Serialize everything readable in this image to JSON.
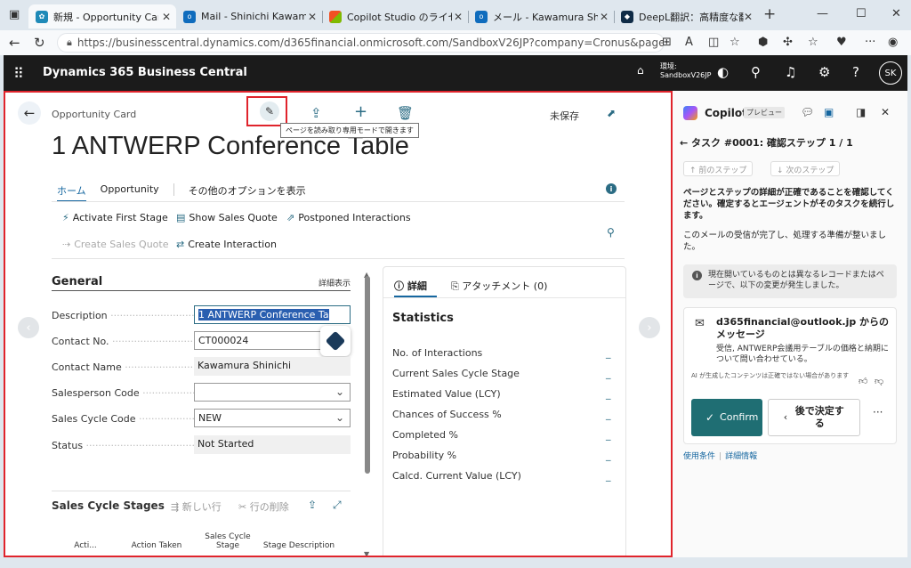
{
  "browser": {
    "tabs": [
      {
        "title": "新規 - Opportunity Card",
        "color": "#1f8ab8"
      },
      {
        "title": "Mail - Shinichi Kawamura -",
        "color": "#0f6cbd"
      },
      {
        "title": "Copilot Studio のライセンス -",
        "color": "#e05a23"
      },
      {
        "title": "メール - Kawamura Shinichi -",
        "color": "#0f6cbd"
      },
      {
        "title": "DeepL翻訳：高精度な翻訳",
        "color": "#0f2b46"
      }
    ],
    "new_tab": "+",
    "url": "https://businesscentral.dynamics.com/d365financial.onmicrosoft.com/SandboxV26JP?company=Cronus&page=5124&filter=Opport..."
  },
  "bc": {
    "app_name": "Dynamics 365 Business Central",
    "env_label": "環境:",
    "env_name": "SandboxV26JP",
    "avatar": "SK"
  },
  "card": {
    "type": "Opportunity Card",
    "title": "1 ANTWERP Conference Table",
    "tooltip": "ページを読み取り専用モードで開きます",
    "unsaved": "未保存",
    "tabs": [
      "ホーム",
      "Opportunity",
      "その他のオプションを表示"
    ],
    "info": "i",
    "actions": {
      "activate_first_stage": "Activate First Stage",
      "show_sales_quote": "Show Sales Quote",
      "postponed_interactions": "Postponed Interactions",
      "create_sales_quote": "Create Sales Quote",
      "create_interaction": "Create Interaction"
    },
    "general": {
      "title": "General",
      "show_more": "詳細表示",
      "fields": {
        "description_label": "Description",
        "description_value": "1  ANTWERP Conference Ta",
        "contact_no_label": "Contact No.",
        "contact_no_value": "CT000024",
        "contact_name_label": "Contact Name",
        "contact_name_value": "Kawamura Shinichi",
        "salesperson_label": "Salesperson Code",
        "salesperson_value": "",
        "sales_cycle_label": "Sales Cycle Code",
        "sales_cycle_value": "NEW",
        "status_label": "Status",
        "status_value": "Not Started"
      }
    },
    "sales_cycle_stages": {
      "title": "Sales Cycle Stages",
      "new_line": "新しい行",
      "delete_line": "行の削除",
      "columns": [
        "Acti...",
        "Action Taken",
        "Sales Cycle Stage",
        "Stage Description"
      ]
    }
  },
  "factbox": {
    "tab_details": "詳細",
    "tab_attachments": "アタッチメント (0)",
    "statistics_title": "Statistics",
    "stats": [
      {
        "label": "No. of Interactions",
        "value": "_"
      },
      {
        "label": "Current Sales Cycle Stage",
        "value": "_"
      },
      {
        "label": "Estimated Value (LCY)",
        "value": "_"
      },
      {
        "label": "Chances of Success %",
        "value": "_"
      },
      {
        "label": "Completed %",
        "value": "_"
      },
      {
        "label": "Probability %",
        "value": "_"
      },
      {
        "label": "Calcd. Current Value (LCY)",
        "value": "_"
      }
    ]
  },
  "copilot": {
    "title": "Copilot",
    "badge": "プレビュー",
    "task": "タスク #0001: 確認ステップ 1 / 1",
    "prev_step": "前のステップ",
    "next_step": "次のステップ",
    "msg1": "ページとステップの詳細が正確であることを確認してください。確定するとエージェントがそのタスクを続行します。",
    "msg2": "このメールの受信が完了し、処理する準備が整いました。",
    "note": "現在開いているものとは異なるレコードまたはページで、以下の変更が発生しました。",
    "mail_head": "d365financial@outlook.jp からのメッセージ",
    "mail_body": "受信, ANTWERP会議用テーブルの価格と納期について問い合わせている。",
    "ai_note": "AI が生成したコンテンツは正確ではない場合があります",
    "confirm": "Confirm",
    "later": "後で決定する",
    "more": "···",
    "terms": "使用条件",
    "details": "詳細情報"
  }
}
